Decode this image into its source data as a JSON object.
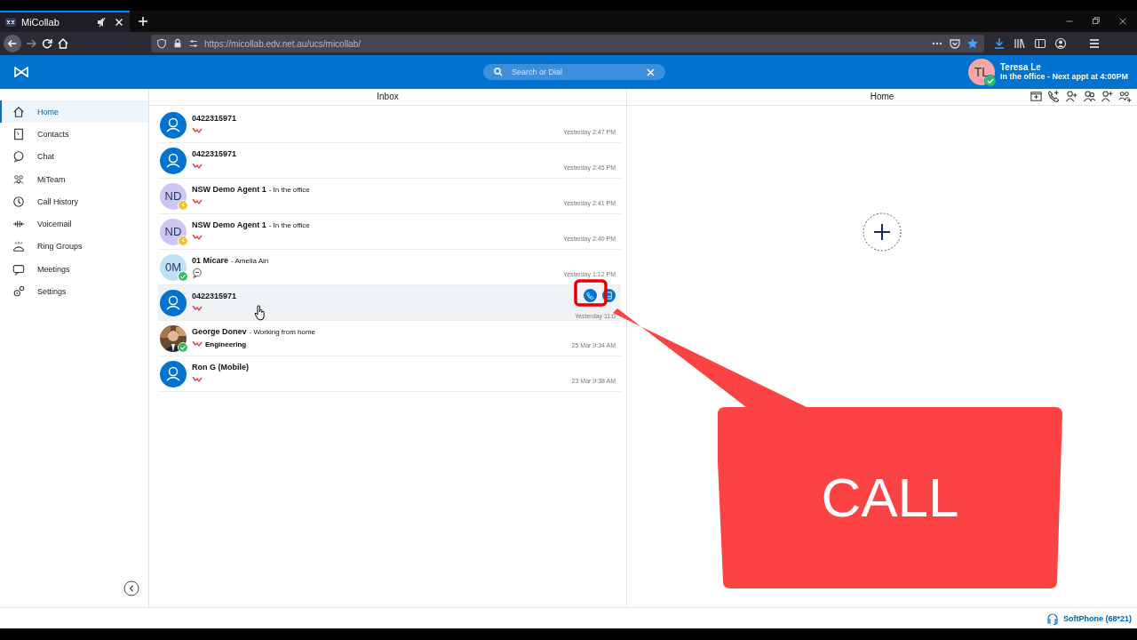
{
  "browser": {
    "tab_title": "MiCollab",
    "url": "https://micollab.edv.net.au/ucs/micollab/"
  },
  "header": {
    "search": {
      "placeholder": "Search or Dial"
    },
    "user": {
      "initials": "TL",
      "name": "Teresa Le",
      "status": "In the office - Next appt at 4:00PM",
      "badge": {
        "kind": "available"
      }
    }
  },
  "sidebar": {
    "items": [
      {
        "label": "Home",
        "selected": true
      },
      {
        "label": "Contacts",
        "selected": false
      },
      {
        "label": "Chat",
        "selected": false
      },
      {
        "label": "MiTeam",
        "selected": false
      },
      {
        "label": "Call History",
        "selected": false
      },
      {
        "label": "Voicemail",
        "selected": false
      },
      {
        "label": "Ring Groups",
        "selected": false
      },
      {
        "label": "Meetings",
        "selected": false
      },
      {
        "label": "Settings",
        "selected": false
      }
    ]
  },
  "inbox": {
    "title": "Inbox",
    "items": [
      {
        "name": "0422315971",
        "kind": "missed-call",
        "time": "Yesterday 2:47 PM",
        "avatar": {
          "kind": "generic"
        },
        "hovered": false
      },
      {
        "name": "0422315971",
        "kind": "missed-call",
        "time": "Yesterday 2:45 PM",
        "avatar": {
          "kind": "generic"
        },
        "hovered": false
      },
      {
        "name": "NSW Demo Agent 1",
        "status": "- In the office",
        "kind": "missed-call",
        "time": "Yesterday 2:41 PM",
        "avatar": {
          "kind": "initials",
          "initials": "ND",
          "color": "#cdc6f2",
          "badge": {
            "kind": "away"
          }
        },
        "hovered": false
      },
      {
        "name": "NSW Demo Agent 1",
        "status": "- In the office",
        "kind": "missed-call",
        "time": "Yesterday 2:40 PM",
        "avatar": {
          "kind": "initials",
          "initials": "ND",
          "color": "#cdc6f2",
          "badge": {
            "kind": "away"
          }
        },
        "hovered": false
      },
      {
        "name": "01 Micare",
        "status": "- Amelia Ain",
        "kind": "chat",
        "time": "Yesterday 1:12 PM",
        "avatar": {
          "kind": "initials",
          "initials": "0M",
          "color": "#bfe0f5",
          "badge": {
            "kind": "available"
          }
        },
        "hovered": false
      },
      {
        "name": "0422315971",
        "kind": "missed-call",
        "time": "Yesterday 11:0",
        "avatar": {
          "kind": "generic"
        },
        "hovered": true
      },
      {
        "name": "George Donev",
        "status": "- Working from home",
        "detail": "Engineering",
        "kind": "missed-call",
        "time": "25 Mar 9:34 AM",
        "avatar": {
          "kind": "picture",
          "badge": {
            "kind": "available"
          }
        },
        "hovered": false
      },
      {
        "name": "Ron G (Mobile)",
        "kind": "missed-call",
        "time": "23 Mar 9:38 AM",
        "avatar": {
          "kind": "generic"
        },
        "hovered": false
      }
    ]
  },
  "home": {
    "title": "Home"
  },
  "callout": {
    "text": "CALL"
  },
  "status_bar": {
    "label": "SoftPhone (68*21)"
  }
}
